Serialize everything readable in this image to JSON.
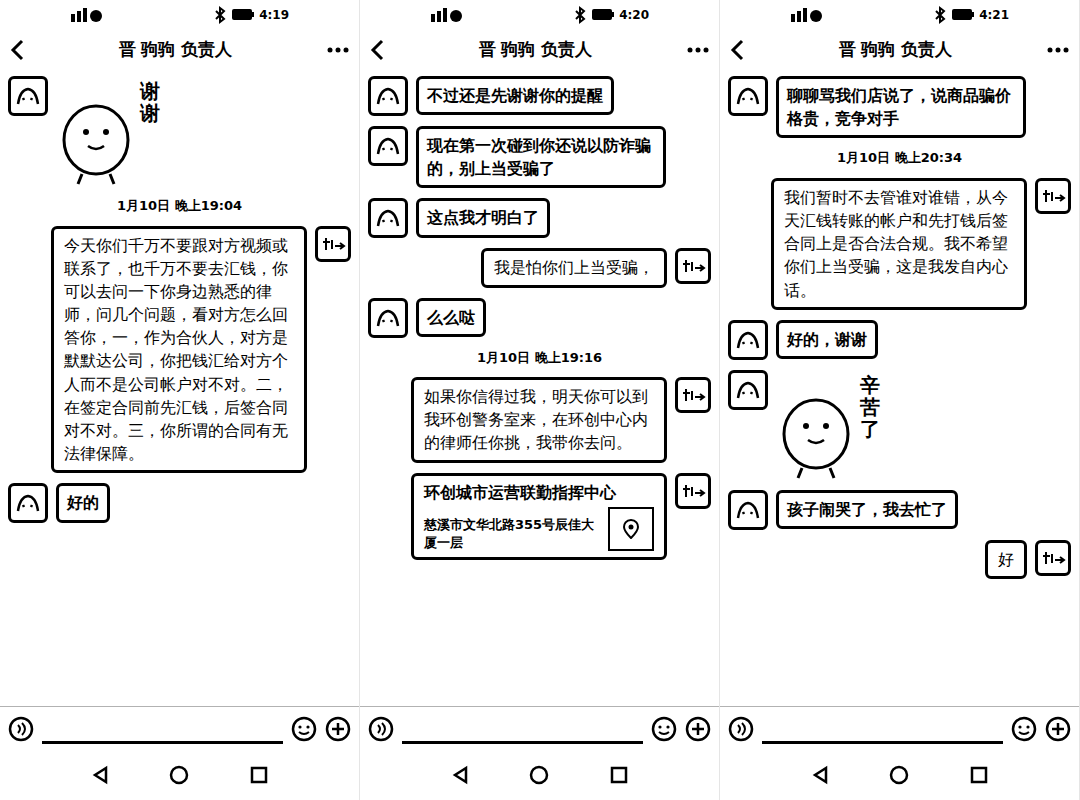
{
  "panels": [
    {
      "status_time": "4:19",
      "title": "晋 驹驹 负责人",
      "messages": [
        {
          "kind": "sticker",
          "text": "谢谢"
        },
        {
          "kind": "time",
          "text": "1月10日 晚上19:04"
        },
        {
          "kind": "outgoing",
          "text": "今天你们千万不要跟对方视频或联系了，也千万不要去汇钱，你可以去问一下你身边熟悉的律师，问几个问题，看对方怎么回答你，一，作为合伙人，对方是默默达公司，你把钱汇给对方个人而不是公司帐户对不对。二，在签定合同前先汇钱，后签合同对不对。三，你所谓的合同有无法律保障。"
        },
        {
          "kind": "incoming",
          "text": "好的"
        }
      ]
    },
    {
      "status_time": "4:20",
      "title": "晋 驹驹 负责人",
      "messages": [
        {
          "kind": "incoming",
          "text": "不过还是先谢谢你的提醒"
        },
        {
          "kind": "incoming",
          "text": "现在第一次碰到你还说以防诈骗的，别上当受骗了"
        },
        {
          "kind": "incoming",
          "text": "这点我才明白了"
        },
        {
          "kind": "outgoing",
          "text": "我是怕你们上当受骗，"
        },
        {
          "kind": "incoming",
          "text": "么么哒"
        },
        {
          "kind": "time",
          "text": "1月10日 晚上19:16"
        },
        {
          "kind": "outgoing",
          "text": "如果你信得过我，明天你可以到我环创警务室来，在环创中心内的律师任你挑，我带你去问。"
        },
        {
          "kind": "location",
          "text": "环创城市运营联勤指挥中心",
          "address": "慈溪市文华北路355号辰佳大厦一层"
        }
      ]
    },
    {
      "status_time": "4:21",
      "title": "晋 驹驹 负责人",
      "messages": [
        {
          "kind": "incoming",
          "text": "聊聊骂我们店说了，说商品骗价格贵，竞争对手"
        },
        {
          "kind": "time",
          "text": "1月10日 晚上20:34"
        },
        {
          "kind": "outgoing",
          "text": "我们暂时不去管谁对谁错，从今天汇钱转账的帐户和先打钱后签合同上是否合法合规。我不希望你们上当受骗，这是我发自内心话。"
        },
        {
          "kind": "incoming",
          "text": "好的，谢谢"
        },
        {
          "kind": "sticker",
          "text": "辛苦了"
        },
        {
          "kind": "incoming",
          "text": "孩子闹哭了，我去忙了"
        },
        {
          "kind": "outgoing",
          "text": "好"
        }
      ]
    }
  ]
}
